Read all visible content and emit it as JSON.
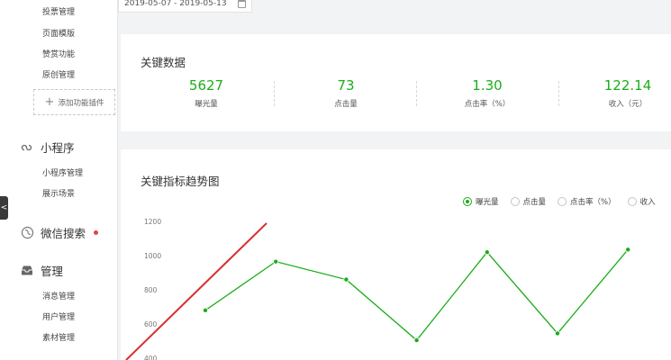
{
  "sidebar": {
    "top_links": [
      {
        "label": "投票管理"
      },
      {
        "label": "页面模版"
      },
      {
        "label": "赞赏功能"
      },
      {
        "label": "原创管理"
      }
    ],
    "plugin_button": "添加功能插件",
    "sections": [
      {
        "title": "小程序",
        "icon": "mini-program-icon",
        "items": [
          {
            "label": "小程序管理"
          },
          {
            "label": "展示场景"
          }
        ]
      },
      {
        "title": "微信搜索",
        "icon": "wechat-search-icon",
        "items": []
      },
      {
        "title": "管理",
        "icon": "inbox-icon",
        "items": [
          {
            "label": "消息管理"
          },
          {
            "label": "用户管理"
          },
          {
            "label": "素材管理"
          }
        ]
      }
    ],
    "collapse_arrow": "<"
  },
  "date_range": "2019-05-07 - 2019-05-13",
  "key_data": {
    "title": "关键数据",
    "metrics": [
      {
        "value": "5627",
        "label": "曝光量"
      },
      {
        "value": "73",
        "label": "点击量"
      },
      {
        "value": "1.30",
        "label": "点击率（%）"
      },
      {
        "value": "122.14",
        "label": "收入（元）"
      }
    ]
  },
  "trend": {
    "title": "关键指标趋势图",
    "legend": [
      {
        "label": "曝光量",
        "selected": true
      },
      {
        "label": "点击量",
        "selected": false
      },
      {
        "label": "点击率（%）",
        "selected": false
      },
      {
        "label": "收入",
        "selected": false
      }
    ]
  },
  "colors": {
    "accent": "#1aad19",
    "annotation_arrow": "#d9302c"
  },
  "chart_data": {
    "type": "line",
    "x": [
      1,
      2,
      3,
      4,
      5,
      6,
      7
    ],
    "series": [
      {
        "name": "曝光量",
        "values": [
          680,
          965,
          860,
          505,
          1020,
          545,
          1035
        ]
      }
    ],
    "y_ticks": [
      "1200",
      "1000",
      "800",
      "600",
      "400"
    ],
    "ylim": [
      400,
      1200
    ],
    "grid": false
  }
}
